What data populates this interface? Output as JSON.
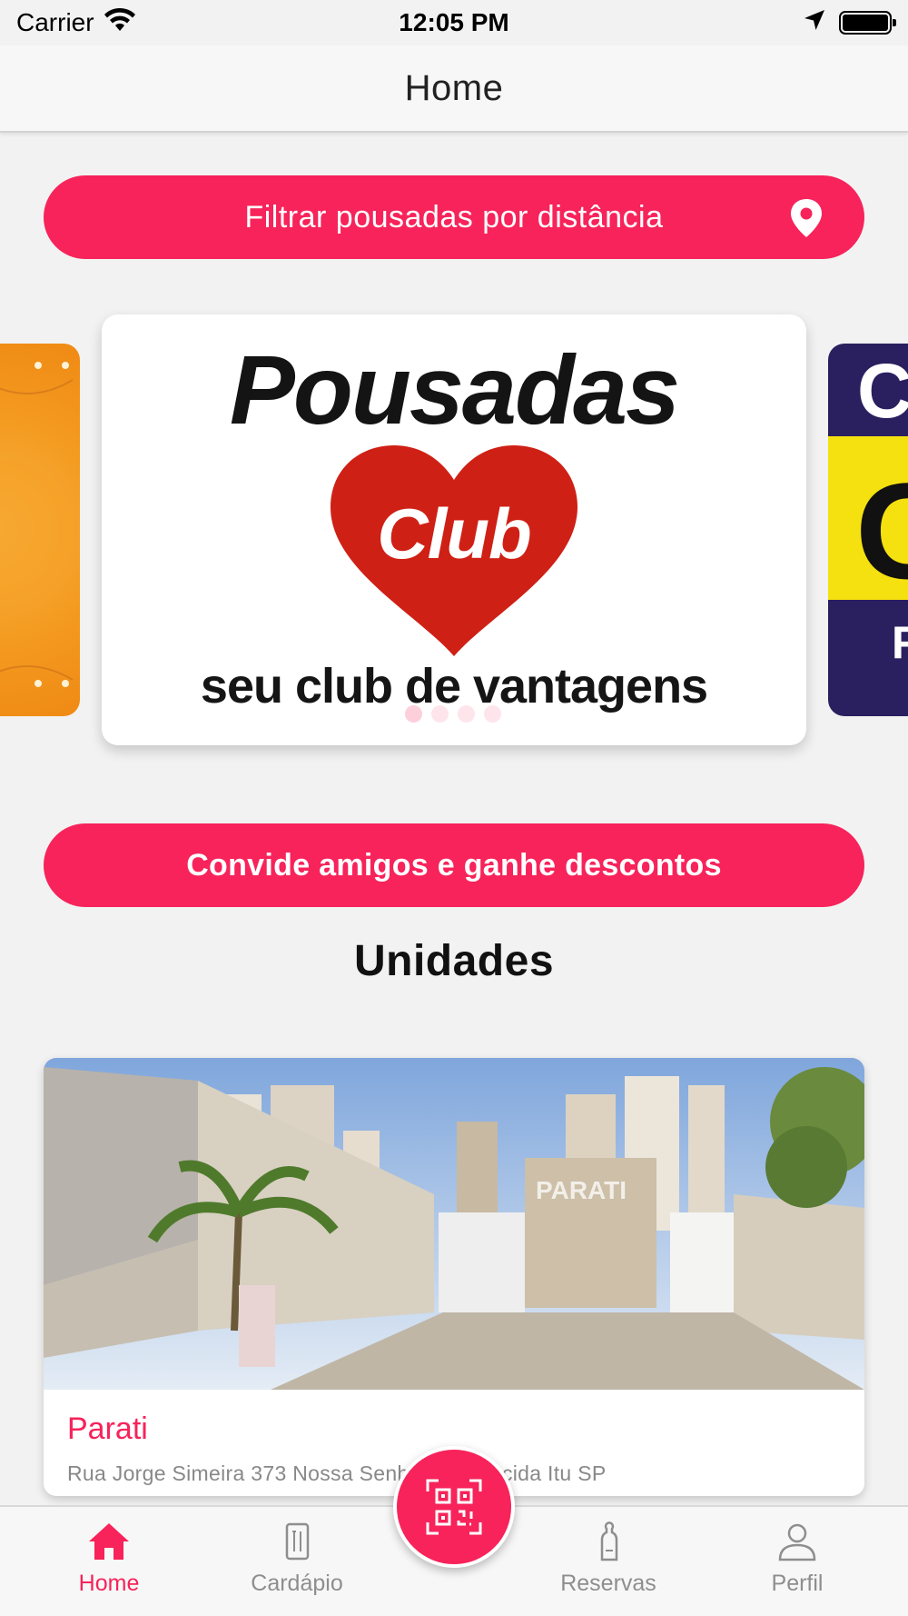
{
  "status_bar": {
    "carrier": "Carrier",
    "time": "12:05 PM",
    "icons": [
      "wifi-icon",
      "location-arrow-icon",
      "battery-icon"
    ]
  },
  "nav": {
    "title": "Home"
  },
  "filter_button": {
    "label": "Filtrar pousadas por distância",
    "icon": "map-pin-icon"
  },
  "carousel": {
    "main_slide": {
      "title": "Pousadas",
      "heart_text": "Club",
      "tagline": "seu club de vantagens"
    },
    "page_count": 4,
    "active_index": 0
  },
  "invite_button": {
    "label": "Convide amigos e ganhe descontos"
  },
  "units": {
    "section_title": "Unidades",
    "items": [
      {
        "name": "Parati",
        "address": "Rua Jorge Simeira 373 Nossa Senhora Aparecida Itu SP",
        "photo_sign": "PARATI"
      }
    ]
  },
  "tab_bar": {
    "tabs": [
      {
        "label": "Home",
        "icon": "home-icon",
        "active": true
      },
      {
        "label": "Cardápio",
        "icon": "menu-book-icon",
        "active": false
      },
      {
        "label": "Reservas",
        "icon": "door-hanger-icon",
        "active": false
      },
      {
        "label": "Perfil",
        "icon": "person-icon",
        "active": false
      }
    ],
    "center_action_icon": "qr-code-icon"
  },
  "colors": {
    "accent": "#f7235a",
    "background": "#f2f2f2",
    "heart": "#cf2016",
    "inactive_tab": "#8e8e8e"
  }
}
